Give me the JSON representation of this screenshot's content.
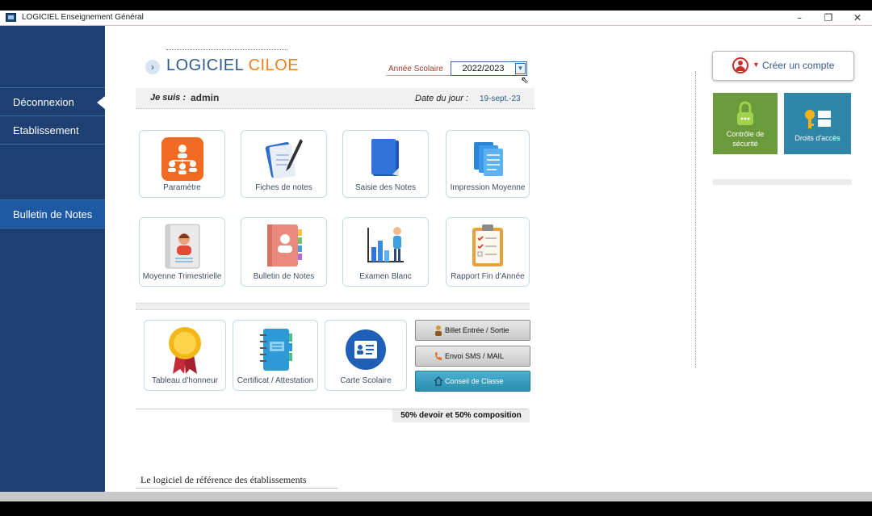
{
  "window": {
    "title": "LOGICIEL Enseignement Général"
  },
  "sidebar": {
    "items": [
      {
        "label": "Déconnexion"
      },
      {
        "label": "Etablissement"
      },
      {
        "label": "Bulletin de Notes"
      }
    ]
  },
  "header": {
    "logo_primary": "LOGICIEL",
    "logo_secondary": "CILOE",
    "annee_label": "Année Scolaire",
    "annee_value": "2022/2023"
  },
  "user_bar": {
    "je_suis_label": "Je suis :",
    "username": "admin",
    "date_label": "Date du jour :",
    "date_value": "19-sept.-23"
  },
  "tiles": [
    {
      "label": "Paramètre",
      "icon": "users-org-icon"
    },
    {
      "label": "Fiches de notes",
      "icon": "notebook-pen-icon"
    },
    {
      "label": "Saisie des Notes",
      "icon": "blue-book-icon"
    },
    {
      "label": "Impression Moyenne",
      "icon": "documents-icon"
    },
    {
      "label": "Moyenne Trimestrielle",
      "icon": "student-book-icon"
    },
    {
      "label": "Bulletin de Notes",
      "icon": "contact-book-icon"
    },
    {
      "label": "Examen Blanc",
      "icon": "bar-chart-person-icon"
    },
    {
      "label": "Rapport Fin d'Année",
      "icon": "clipboard-checklist-icon"
    },
    {
      "label": "Tableau d'honneur",
      "icon": "award-medal-icon"
    },
    {
      "label": "Certificat / Attestation",
      "icon": "spiral-notebook-icon"
    },
    {
      "label": "Carte Scolaire",
      "icon": "id-card-icon"
    }
  ],
  "buttons": {
    "billet": "Billet Entrée / Sortie",
    "sms": "Envoi SMS / MAIL",
    "conseil": "Conseil de Classe"
  },
  "formula": "50% devoir et  50% composition",
  "footer": "Le logiciel de référence des établissements",
  "right_panel": {
    "create_account": "Créer un compte",
    "security_line1": "Contrôle de",
    "security_line2": "sécurité",
    "rights": "Droits d'accès"
  },
  "colors": {
    "sidebar": "#1e3f72",
    "accent_orange": "#e8821f",
    "security_green": "#6b9a3a",
    "rights_teal": "#2f86a8"
  }
}
